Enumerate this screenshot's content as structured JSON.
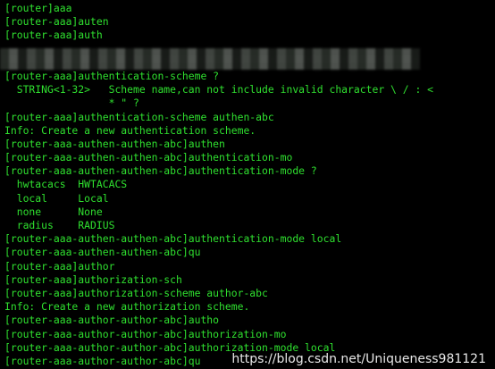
{
  "terminal": {
    "lines": [
      "[router]aaa",
      "[router-aaa]auten",
      "[router-aaa]auth",
      "",
      "",
      "[router-aaa]authentication-scheme ?",
      "  STRING<1-32>   Scheme name,can not include invalid character \\ / : <",
      "                 * \" ?",
      "[router-aaa]authentication-scheme authen-abc",
      "Info: Create a new authentication scheme.",
      "[router-aaa-authen-authen-abc]authen",
      "[router-aaa-authen-authen-abc]authentication-mo",
      "[router-aaa-authen-authen-abc]authentication-mode ?",
      "  hwtacacs  HWTACACS",
      "  local     Local",
      "  none      None",
      "  radius    RADIUS",
      "[router-aaa-authen-authen-abc]authentication-mode local",
      "[router-aaa-authen-authen-abc]qu",
      "[router-aaa]author",
      "[router-aaa]authorization-sch",
      "[router-aaa]authorization-scheme author-abc",
      "Info: Create a new authorization scheme.",
      "[router-aaa-author-author-abc]autho",
      "[router-aaa-author-author-abc]authorization-mo",
      "[router-aaa-author-author-abc]authorization-mode local",
      "[router-aaa-author-author-abc]qu"
    ],
    "text_color": "#2fe02f",
    "background_color": "#000000"
  },
  "watermark": {
    "text": "https://blog.csdn.net/Uniqueness981121"
  }
}
